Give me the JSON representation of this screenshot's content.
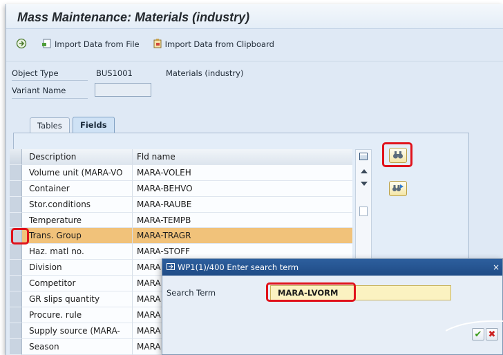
{
  "window": {
    "title": "Mass Maintenance: Materials (industry)"
  },
  "toolbar": {
    "execute_icon": "execute-icon",
    "import_file_label": "Import Data from File",
    "import_clipboard_label": "Import Data from Clipboard"
  },
  "header": {
    "object_type_label": "Object Type",
    "object_type_value": "BUS1001",
    "object_type_desc": "Materials (industry)",
    "variant_name_label": "Variant Name",
    "variant_name_value": ""
  },
  "tabs": [
    {
      "label": "Tables",
      "active": false
    },
    {
      "label": "Fields",
      "active": true
    }
  ],
  "table": {
    "columns": [
      "Description",
      "Fld name"
    ],
    "rows": [
      {
        "desc": "Volume unit (MARA-VO",
        "fld": "MARA-VOLEH"
      },
      {
        "desc": "Container",
        "fld": "MARA-BEHVO"
      },
      {
        "desc": "Stor.conditions",
        "fld": "MARA-RAUBE"
      },
      {
        "desc": "Temperature",
        "fld": "MARA-TEMPB"
      },
      {
        "desc": "Trans. Group",
        "fld": "MARA-TRAGR",
        "highlighted": true
      },
      {
        "desc": "Haz. matl no.",
        "fld": "MARA-STOFF"
      },
      {
        "desc": "Division",
        "fld": "MARA"
      },
      {
        "desc": "Competitor",
        "fld": "MARA"
      },
      {
        "desc": "GR slips quantity",
        "fld": "MARA"
      },
      {
        "desc": "Procure. rule",
        "fld": "MARA"
      },
      {
        "desc": "Supply source (MARA-",
        "fld": "MARA"
      },
      {
        "desc": "Season",
        "fld": "MARA"
      }
    ]
  },
  "dialog": {
    "title": "WP1(1)/400 Enter search term",
    "close": "×",
    "search_label": "Search Term",
    "search_value": "MARA-LVORM",
    "ok": "✔",
    "cancel": "✖"
  },
  "colors": {
    "highlight_row": "#f1c27a",
    "annotation_red": "#e0121b",
    "dialog_title": "#1f4b86"
  }
}
